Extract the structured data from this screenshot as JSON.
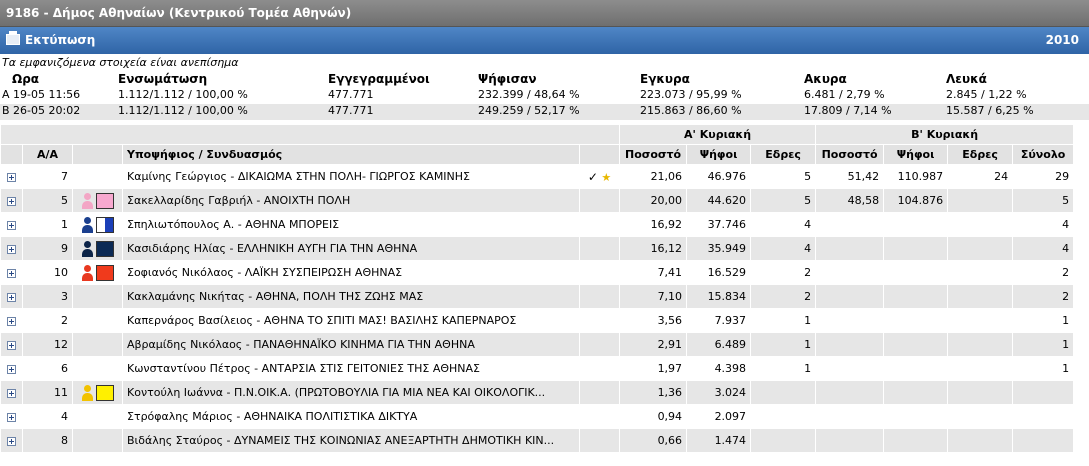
{
  "window": {
    "title": "9186 - Δήμος Αθηναίων (Κεντρικού Τομέα Αθηνών)"
  },
  "printbar": {
    "print_label": "Εκτύπωση",
    "year": "2010"
  },
  "note": "Τα εμφανιζόμενα στοιχεία είναι ανεπίσημα",
  "turnout": {
    "headers": {
      "ora": "Ωρα",
      "ensomatosi": "Ενσωμάτωση",
      "eggegrammenoi": "Εγγεγραμμένοι",
      "psifisan": "Ψήφισαν",
      "egkyra": "Εγκυρα",
      "akyra": "Ακυρα",
      "lefka": "Λευκά"
    },
    "rows": [
      {
        "ora": "Α 19-05 11:56",
        "ensomatosi": "1.112/1.112 / 100,00 %",
        "eggegrammenoi": "477.771",
        "psifisan": "232.399 / 48,64 %",
        "egkyra": "223.073 / 95,99 %",
        "akyra": "6.481 / 2,79 %",
        "lefka": "2.845 / 1,22 %"
      },
      {
        "ora": "Β 26-05 20:02",
        "ensomatosi": "1.112/1.112 / 100,00 %",
        "eggegrammenoi": "477.771",
        "psifisan": "249.259 / 52,17 %",
        "egkyra": "215.863 / 86,60 %",
        "akyra": "17.809 / 7,14 %",
        "lefka": "15.587 / 6,25 %"
      }
    ]
  },
  "results": {
    "round_a": "Α' Κυριακή",
    "round_b": "Β' Κυριακή",
    "col_aa": "Α/Α",
    "col_candidate": "Υποψήφιος / Συνδυασμός",
    "col_pososto": "Ποσοστό",
    "col_psifoi": "Ψήφοι",
    "col_edres": "Εδρες",
    "col_synolo": "Σύνολο",
    "winner_check": "✓",
    "winner_star": "★",
    "rows": [
      {
        "aa": "7",
        "name": "Καμίνης Γεώργιος - ΔΙΚΑΙΩΜΑ ΣΤΗΝ ΠΟΛΗ- ΓΙΩΡΓΟΣ ΚΑΜΙΝΗΣ",
        "winner": true,
        "icon": null,
        "a_pct": "21,06",
        "a_votes": "46.976",
        "a_seats": "5",
        "b_pct": "51,42",
        "b_votes": "110.987",
        "b_seats": "24",
        "total": "29"
      },
      {
        "aa": "5",
        "name": "Σακελλαρίδης Γαβριήλ - ΑΝΟΙΧΤΗ ΠΟΛΗ",
        "winner": false,
        "icon": {
          "person": "#f3a6c5",
          "swatch": "#f7a8cf"
        },
        "a_pct": "20,00",
        "a_votes": "44.620",
        "a_seats": "5",
        "b_pct": "48,58",
        "b_votes": "104.876",
        "b_seats": "",
        "total": "5"
      },
      {
        "aa": "1",
        "name": "Σπηλιωτόπουλος Α. - ΑΘΗΝΑ ΜΠΟΡΕΙΣ",
        "winner": false,
        "icon": {
          "person": "#1b3f8e",
          "swatch": "linear-gradient(90deg,#ffffff 50%,#1b3fb8 50%)"
        },
        "a_pct": "16,92",
        "a_votes": "37.746",
        "a_seats": "4",
        "b_pct": "",
        "b_votes": "",
        "b_seats": "",
        "total": "4"
      },
      {
        "aa": "9",
        "name": "Κασιδιάρης Ηλίας - ΕΛΛΗΝΙΚΗ ΑΥΓΗ ΓΙΑ ΤΗΝ ΑΘΗΝΑ",
        "winner": false,
        "icon": {
          "person": "#0c2448",
          "swatch": "#0c2a55"
        },
        "a_pct": "16,12",
        "a_votes": "35.949",
        "a_seats": "4",
        "b_pct": "",
        "b_votes": "",
        "b_seats": "",
        "total": "4"
      },
      {
        "aa": "10",
        "name": "Σοφιανός Νικόλαος - ΛΑΪΚΗ ΣΥΣΠΕΙΡΩΣΗ ΑΘΗΝΑΣ",
        "winner": false,
        "icon": {
          "person": "#e8381f",
          "swatch": "#f03a1c"
        },
        "a_pct": "7,41",
        "a_votes": "16.529",
        "a_seats": "2",
        "b_pct": "",
        "b_votes": "",
        "b_seats": "",
        "total": "2"
      },
      {
        "aa": "3",
        "name": "Κακλαμάνης Νικήτας - ΑΘΗΝΑ, ΠΟΛΗ ΤΗΣ ΖΩΗΣ ΜΑΣ",
        "winner": false,
        "icon": null,
        "a_pct": "7,10",
        "a_votes": "15.834",
        "a_seats": "2",
        "b_pct": "",
        "b_votes": "",
        "b_seats": "",
        "total": "2"
      },
      {
        "aa": "2",
        "name": "Καπερνάρος Βασίλειος - ΑΘΗΝΑ ΤΟ ΣΠΙΤΙ ΜΑΣ! ΒΑΣΙΛΗΣ ΚΑΠΕΡΝΑΡΟΣ",
        "winner": false,
        "icon": null,
        "a_pct": "3,56",
        "a_votes": "7.937",
        "a_seats": "1",
        "b_pct": "",
        "b_votes": "",
        "b_seats": "",
        "total": "1"
      },
      {
        "aa": "12",
        "name": "Αβραμίδης Νικόλαος - ΠΑΝΑΘΗΝΑΪΚΟ ΚΙΝΗΜΑ ΓΙΑ ΤΗΝ ΑΘΗΝΑ",
        "winner": false,
        "icon": null,
        "a_pct": "2,91",
        "a_votes": "6.489",
        "a_seats": "1",
        "b_pct": "",
        "b_votes": "",
        "b_seats": "",
        "total": "1"
      },
      {
        "aa": "6",
        "name": "Κωνσταντίνου Πέτρος - ΑΝΤΑΡΣΙΑ ΣΤΙΣ ΓΕΙΤΟΝΙΕΣ ΤΗΣ ΑΘΗΝΑΣ",
        "winner": false,
        "icon": null,
        "a_pct": "1,97",
        "a_votes": "4.398",
        "a_seats": "1",
        "b_pct": "",
        "b_votes": "",
        "b_seats": "",
        "total": "1"
      },
      {
        "aa": "11",
        "name": "Κοντούλη Ιωάννα - Π.Ν.ΟΙΚ.Α. (ΠΡΩΤΟΒΟΥΛΙΑ ΓΙΑ ΜΙΑ ΝΕΑ ΚΑΙ ΟΙΚΟΛΟΓΙΚ...",
        "winner": false,
        "icon": {
          "person": "#f2c200",
          "swatch": "#fff000"
        },
        "a_pct": "1,36",
        "a_votes": "3.024",
        "a_seats": "",
        "b_pct": "",
        "b_votes": "",
        "b_seats": "",
        "total": ""
      },
      {
        "aa": "4",
        "name": "Στρόφαλης Μάριος - ΑΘΗΝΑΙΚΑ ΠΟΛΙΤΙΣΤΙΚΑ ΔΙΚΤΥΑ",
        "winner": false,
        "icon": null,
        "a_pct": "0,94",
        "a_votes": "2.097",
        "a_seats": "",
        "b_pct": "",
        "b_votes": "",
        "b_seats": "",
        "total": ""
      },
      {
        "aa": "8",
        "name": "Βιδάλης Σταύρος - ΔΥΝΑΜΕΙΣ ΤΗΣ ΚΟΙΝΩΝΙΑΣ ΑΝΕΞΑΡΤΗΤΗ ΔΗΜΟΤΙΚΗ ΚΙΝ...",
        "winner": false,
        "icon": null,
        "a_pct": "0,66",
        "a_votes": "1.474",
        "a_seats": "",
        "b_pct": "",
        "b_votes": "",
        "b_seats": "",
        "total": ""
      }
    ]
  }
}
